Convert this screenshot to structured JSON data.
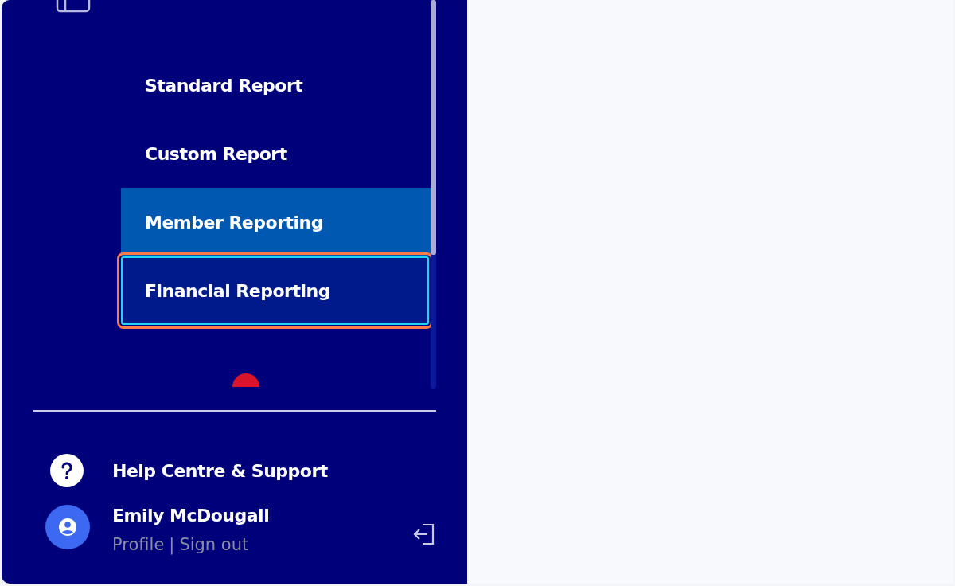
{
  "sidebar": {
    "menu_items": [
      {
        "label": "Standard Report",
        "selected": false,
        "focused": false
      },
      {
        "label": "Custom Report",
        "selected": false,
        "focused": false
      },
      {
        "label": "Member Reporting",
        "selected": true,
        "focused": false
      },
      {
        "label": "Financial Reporting",
        "selected": false,
        "focused": true
      }
    ],
    "help_link": "Help Centre & Support",
    "user": {
      "name": "Emily McDougall",
      "profile_link": "Profile",
      "separator": "|",
      "sign_out_link": "Sign out"
    }
  }
}
